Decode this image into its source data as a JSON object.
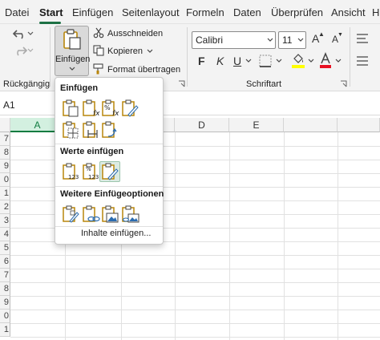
{
  "tabs": [
    "Datei",
    "Start",
    "Einfügen",
    "Seitenlayout",
    "Formeln",
    "Daten",
    "Überprüfen",
    "Ansicht",
    "H"
  ],
  "ribbon": {
    "undo_group_label": "Rückgängig",
    "paste_label": "Einfügen",
    "cut_label": "Ausschneiden",
    "copy_label": "Kopieren",
    "format_painter_label": "Format übertragen",
    "font_name": "Calibri",
    "font_size": "11",
    "font_group_label": "Schriftart",
    "bold_label": "F",
    "italic_label": "K",
    "underline_label": "U",
    "grow_font_label": "A",
    "shrink_font_label": "A"
  },
  "name_box": "A1",
  "columns": [
    "A",
    "D",
    "E"
  ],
  "rows": [
    "7",
    "8",
    "9",
    "0",
    "1",
    "2",
    "3",
    "4",
    "5",
    "6",
    "7",
    "8",
    "9",
    "0",
    "1"
  ],
  "paste_menu": {
    "section_paste": "Einfügen",
    "section_values": "Werte einfügen",
    "section_other": "Weitere Einfügeoptionen",
    "paste_special": "Inhalte einfügen...",
    "badge_123": "123",
    "badge_fx": "fx",
    "badge_pct": "%"
  },
  "colors": {
    "accent": "#1e7145",
    "font_color": "#e81123",
    "fill_color": "#ffff00",
    "clip_brown": "#b8860b"
  }
}
